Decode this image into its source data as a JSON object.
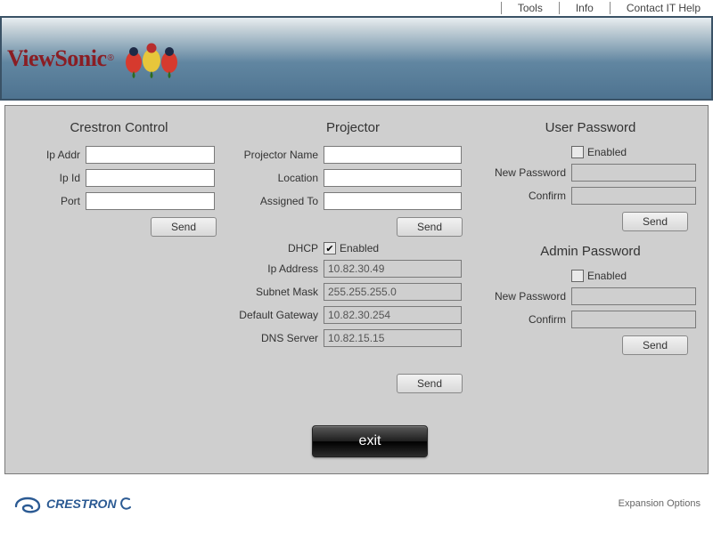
{
  "nav": {
    "tools": "Tools",
    "info": "Info",
    "help": "Contact IT Help"
  },
  "brand": {
    "name": "ViewSonic",
    "footer": "CRESTRON",
    "expansion": "Expansion Options"
  },
  "crestron": {
    "title": "Crestron Control",
    "ip_addr_label": "Ip Addr",
    "ip_addr": "",
    "ip_id_label": "Ip Id",
    "ip_id": "",
    "port_label": "Port",
    "port": "",
    "send": "Send"
  },
  "projector": {
    "title": "Projector",
    "name_label": "Projector Name",
    "name": "",
    "location_label": "Location",
    "location": "",
    "assigned_label": "Assigned To",
    "assigned": "",
    "send1": "Send",
    "dhcp_label": "DHCP",
    "dhcp_enabled_label": "Enabled",
    "dhcp_enabled": true,
    "ip_label": "Ip Address",
    "ip": "10.82.30.49",
    "mask_label": "Subnet Mask",
    "mask": "255.255.255.0",
    "gw_label": "Default Gateway",
    "gw": "10.82.30.254",
    "dns_label": "DNS Server",
    "dns": "10.82.15.15",
    "send2": "Send"
  },
  "userpw": {
    "title": "User Password",
    "enabled_label": "Enabled",
    "enabled": false,
    "new_label": "New Password",
    "new": "",
    "confirm_label": "Confirm",
    "confirm": "",
    "send": "Send"
  },
  "adminpw": {
    "title": "Admin Password",
    "enabled_label": "Enabled",
    "enabled": false,
    "new_label": "New Password",
    "new": "",
    "confirm_label": "Confirm",
    "confirm": "",
    "send": "Send"
  },
  "exit": "exit"
}
